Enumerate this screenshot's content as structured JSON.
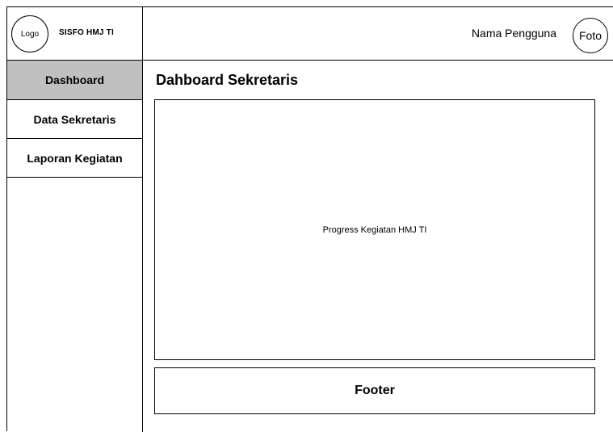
{
  "header": {
    "logo_text": "Logo",
    "app_name": "SISFO HMJ TI",
    "user_name": "Nama Pengguna",
    "avatar_text": "Foto"
  },
  "sidebar": {
    "items": [
      {
        "label": "Dashboard",
        "active": true
      },
      {
        "label": "Data Sekretaris",
        "active": false
      },
      {
        "label": "Laporan Kegiatan",
        "active": false
      }
    ]
  },
  "main": {
    "title": "Dahboard Sekretaris",
    "content_placeholder": "Progress Kegiatan HMJ TI"
  },
  "footer": {
    "label": "Footer"
  },
  "colors": {
    "active_nav_bg": "#c0c0c0",
    "border": "#000000",
    "background": "#ffffff"
  }
}
